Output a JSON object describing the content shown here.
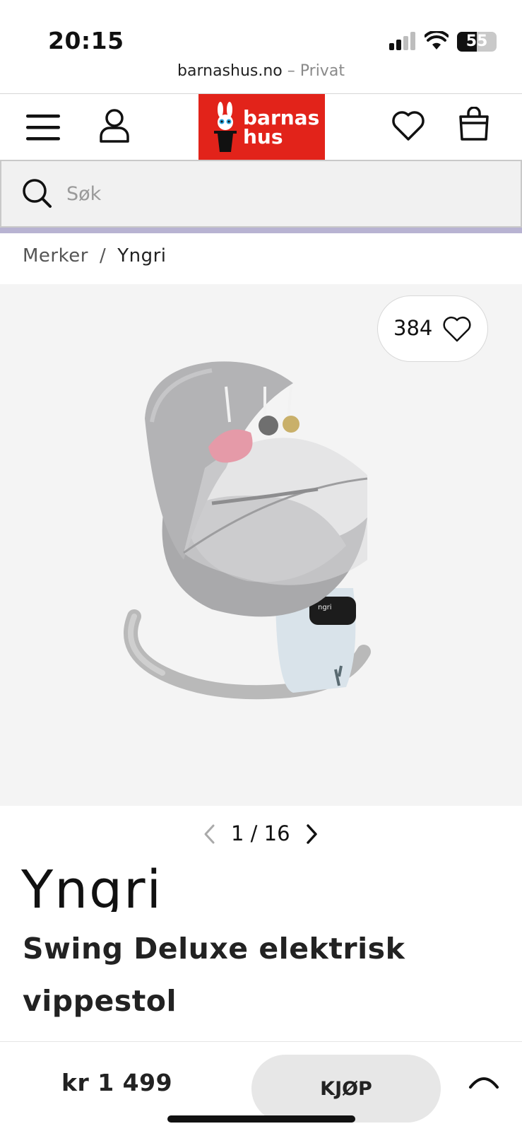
{
  "status_bar": {
    "time": "20:15",
    "battery": "55"
  },
  "browser": {
    "domain": "barnashus.no",
    "mode": "– Privat"
  },
  "header": {
    "logo_line1": "barnas",
    "logo_line2": "hus",
    "brand_color": "#e2231a"
  },
  "search": {
    "placeholder": "Søk",
    "value": ""
  },
  "breadcrumb": {
    "items": [
      "Merker",
      "Yngri"
    ],
    "separator": "/"
  },
  "gallery": {
    "favorites_count": "384",
    "current": "1",
    "total": "/ 16"
  },
  "product": {
    "brand": "Yngri",
    "title": "Swing Deluxe elektrisk vippestol",
    "price": "kr 1 499"
  },
  "actions": {
    "buy_label": "KJØP"
  },
  "colors": {
    "accent_line": "#b8b3d2",
    "gallery_bg": "#f4f4f4",
    "button_bg": "#e7e7e7"
  }
}
